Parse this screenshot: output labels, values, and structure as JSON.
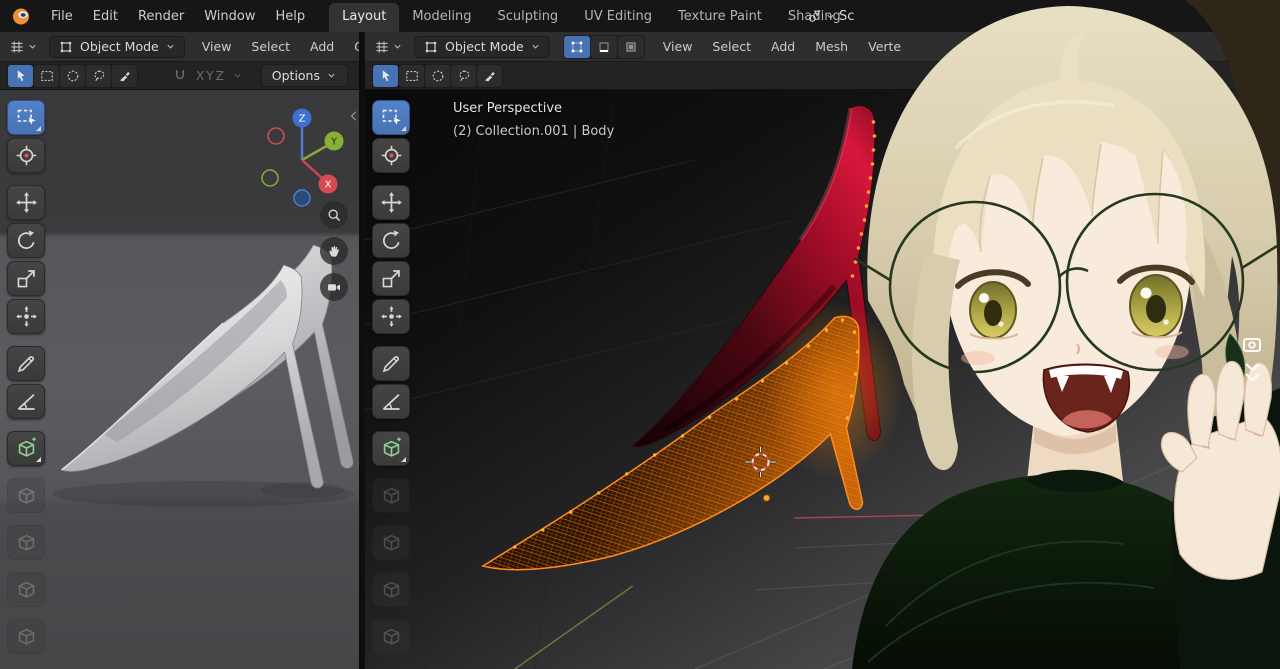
{
  "topbar": {
    "menus": [
      "File",
      "Edit",
      "Render",
      "Window",
      "Help"
    ],
    "tabs": [
      "Layout",
      "Modeling",
      "Sculpting",
      "UV Editing",
      "Texture Paint",
      "Shading"
    ],
    "active_tab": "Layout",
    "scene_label": "Sc"
  },
  "left_viewport": {
    "mode_label": "Object Mode",
    "menus": [
      "View",
      "Select",
      "Add",
      "Ob"
    ],
    "tool_settings": {
      "select_modes": [
        "tweak",
        "box",
        "circle",
        "lasso",
        "paint"
      ],
      "active_select_mode": "tweak",
      "axes_letters": [
        "X",
        "Y",
        "Z"
      ],
      "options_label": "Options"
    },
    "gizmo": {
      "x": "X",
      "y": "Y",
      "z": "Z"
    },
    "nav_buttons": [
      "zoom",
      "pan",
      "camera"
    ]
  },
  "right_viewport": {
    "mode_label": "Object Mode",
    "select_toggles": [
      "vertex-select",
      "edge-select",
      "face-select"
    ],
    "active_select_toggle": "vertex-select",
    "menus": [
      "View",
      "Select",
      "Add",
      "Mesh",
      "Verte"
    ],
    "tool_settings": {
      "select_modes": [
        "tweak",
        "box",
        "circle",
        "lasso",
        "paint"
      ],
      "active_select_mode": "tweak"
    },
    "overlay": {
      "line1": "User Perspective",
      "line2": "(2) Collection.001 | Body"
    }
  },
  "toolbar_tools": [
    {
      "name": "select-box",
      "active": true,
      "has_sub": true
    },
    {
      "name": "cursor"
    },
    {
      "name": "move",
      "gap": true
    },
    {
      "name": "rotate"
    },
    {
      "name": "scale"
    },
    {
      "name": "transform"
    },
    {
      "name": "annotate",
      "gap": true
    },
    {
      "name": "measure"
    },
    {
      "name": "add-cube",
      "gap": true,
      "has_sub": true
    },
    {
      "name": "cube",
      "faded": true,
      "gap": true
    },
    {
      "name": "cube",
      "faded": true,
      "gap": true
    },
    {
      "name": "cube",
      "faded": true,
      "gap": true
    },
    {
      "name": "cube",
      "faded": true,
      "gap": true
    }
  ],
  "colors": {
    "accent_blue": "#4772b3",
    "selection_orange": "#ff8a1e",
    "axis_x": "#d64a52",
    "axis_y": "#86b036",
    "axis_z": "#3f6fd0",
    "shoe_red": "#c3122e",
    "wireframe_orange": "#ff7b00"
  }
}
